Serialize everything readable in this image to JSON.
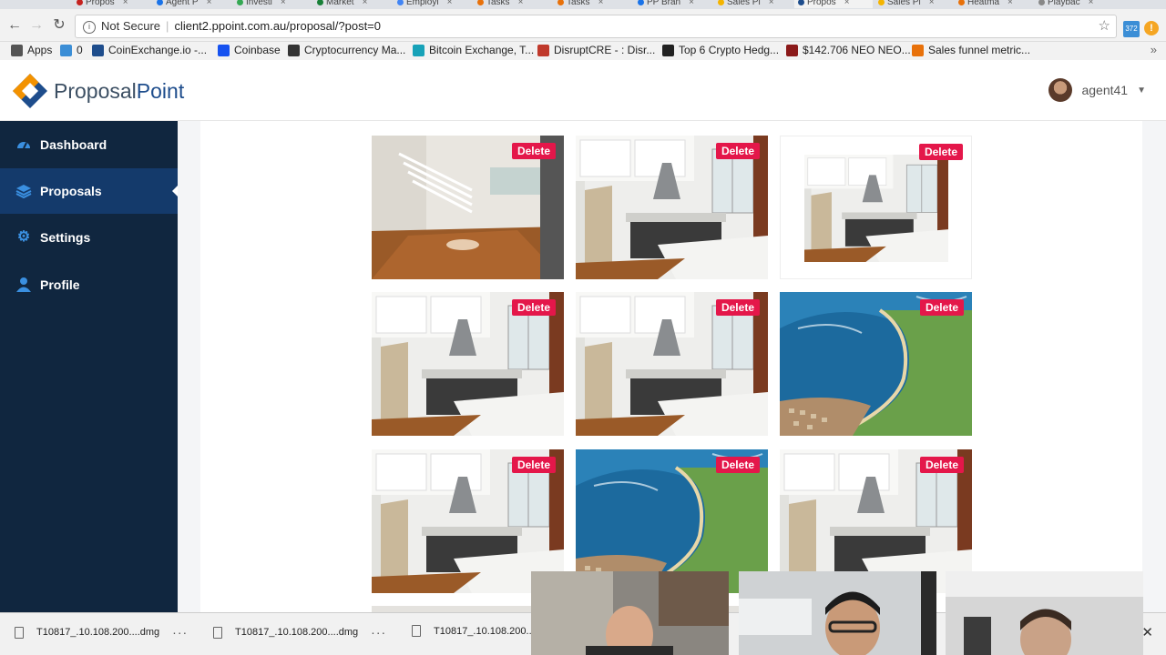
{
  "browser": {
    "tabs": [
      {
        "label": "Propos",
        "color": "#c5221f"
      },
      {
        "label": "Agent P",
        "color": "#1a73e8"
      },
      {
        "label": "Investi",
        "color": "#34a853"
      },
      {
        "label": "Market",
        "color": "#188038"
      },
      {
        "label": "Employi",
        "color": "#4285f4"
      },
      {
        "label": "Tasks",
        "color": "#e8710a"
      },
      {
        "label": "Tasks",
        "color": "#e8710a"
      },
      {
        "label": "PP Bran",
        "color": "#1a73e8"
      },
      {
        "label": "Sales Pl",
        "color": "#f4b400"
      },
      {
        "label": "Propos",
        "color": "#1e4d8c"
      },
      {
        "label": "Sales Pl",
        "color": "#f4b400"
      },
      {
        "label": "Heatma",
        "color": "#e8710a"
      },
      {
        "label": "Playbac",
        "color": "#888888"
      }
    ],
    "not_secure": "Not Secure",
    "url": "client2.ppoint.com.au/proposal/?post=0",
    "ext_badge": "372"
  },
  "bookmarks": [
    {
      "label": "Apps",
      "icon": "apps-grid-icon",
      "color": "#555555"
    },
    {
      "label": "0",
      "icon": "feed-icon",
      "color": "#3b8ed6"
    },
    {
      "label": "CoinExchange.io -...",
      "icon": "ce-icon",
      "color": "#1e4d8c"
    },
    {
      "label": "Coinbase",
      "icon": "coinbase-icon",
      "color": "#1652f0"
    },
    {
      "label": "Cryptocurrency Ma...",
      "icon": "cmc-icon",
      "color": "#333333"
    },
    {
      "label": "Bitcoin Exchange, T...",
      "icon": "bitcoin-exchange-icon",
      "color": "#17a2b8"
    },
    {
      "label": "DisruptCRE - : Disr...",
      "icon": "disrupt-icon",
      "color": "#c0392b"
    },
    {
      "label": "Top 6 Crypto Hedg...",
      "icon": "mx-icon",
      "color": "#222222"
    },
    {
      "label": "$142.706 NEO NEO...",
      "icon": "bs-icon",
      "color": "#8b1a1a"
    },
    {
      "label": "Sales funnel metric...",
      "icon": "s-icon",
      "color": "#e8710a"
    }
  ],
  "header": {
    "logo_text_a": "Proposal",
    "logo_text_b": "Point",
    "username": "agent41"
  },
  "sidebar": {
    "items": [
      {
        "label": "Dashboard",
        "icon": "dashboard-gauge-icon"
      },
      {
        "label": "Proposals",
        "icon": "layers-icon"
      },
      {
        "label": "Settings",
        "icon": "gear-icon"
      },
      {
        "label": "Profile",
        "icon": "user-icon"
      }
    ]
  },
  "gallery": {
    "delete_label": "Delete",
    "images": [
      {
        "kind": "stairs-room"
      },
      {
        "kind": "kitchen"
      },
      {
        "kind": "kitchen-small"
      },
      {
        "kind": "kitchen"
      },
      {
        "kind": "kitchen"
      },
      {
        "kind": "coast-aerial"
      },
      {
        "kind": "kitchen"
      },
      {
        "kind": "coast-aerial"
      },
      {
        "kind": "kitchen"
      }
    ]
  },
  "downloads": {
    "items": [
      {
        "name": "T10817_.10.108.200....dmg"
      },
      {
        "name": "T10817_.10.108.200....dmg"
      },
      {
        "name": "T10817_.10.108.200..."
      }
    ]
  }
}
